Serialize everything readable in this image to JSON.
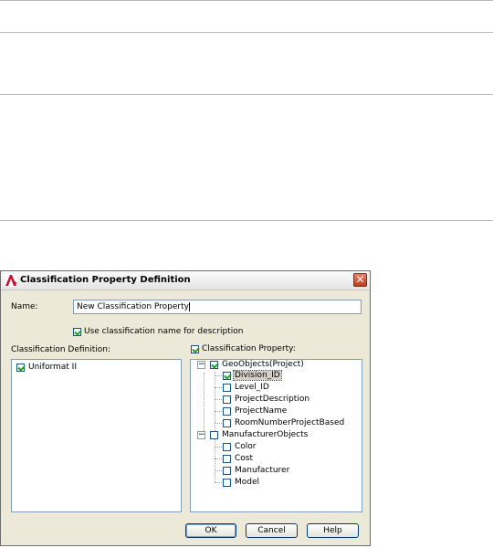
{
  "dialog": {
    "title": "Classification Property Definition",
    "close_glyph": "✕",
    "app_icon": "autocad-app-icon"
  },
  "name": {
    "label": "Name:",
    "value": "New Classification Property"
  },
  "use_description": {
    "label": "Use classification name for description",
    "checked": true
  },
  "classification_definition": {
    "label": "Classification Definition:",
    "items": [
      {
        "label": "Uniformat II",
        "checked": true
      }
    ]
  },
  "classification_property": {
    "label": "Classification Property:",
    "checked": true,
    "groups": [
      {
        "label": "GeoObjects(Project)",
        "checked": true,
        "expanded": true,
        "children": [
          {
            "label": "Division_ID",
            "checked": true,
            "selected": true
          },
          {
            "label": "Level_ID",
            "checked": false
          },
          {
            "label": "ProjectDescription",
            "checked": false
          },
          {
            "label": "ProjectName",
            "checked": false
          },
          {
            "label": "RoomNumberProjectBased",
            "checked": false
          }
        ]
      },
      {
        "label": "ManufacturerObjects",
        "checked": false,
        "expanded": true,
        "children": [
          {
            "label": "Color",
            "checked": false
          },
          {
            "label": "Cost",
            "checked": false
          },
          {
            "label": "Manufacturer",
            "checked": false
          },
          {
            "label": "Model",
            "checked": false
          }
        ]
      }
    ]
  },
  "buttons": {
    "ok": "OK",
    "cancel": "Cancel",
    "help": "Help"
  }
}
